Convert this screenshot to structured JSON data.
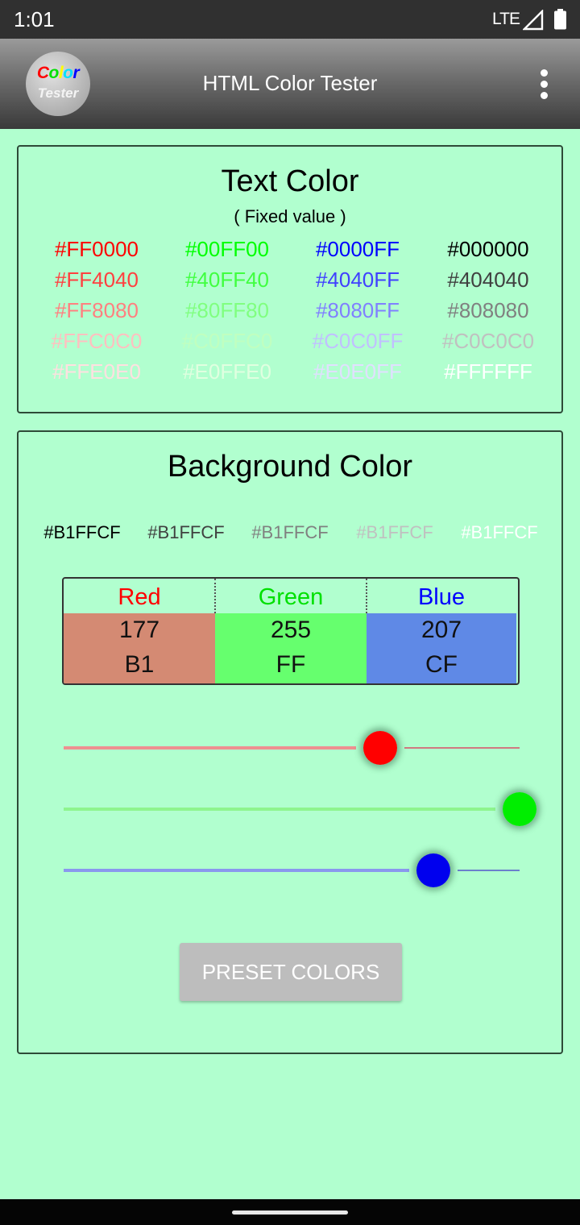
{
  "status_bar": {
    "time": "1:01",
    "network": "LTE",
    "signal_icon": "signal-icon",
    "battery_icon": "battery-icon"
  },
  "app_bar": {
    "title": "HTML Color Tester",
    "logo": {
      "line1_letters": [
        {
          "char": "C",
          "color": "#FF0000"
        },
        {
          "char": "o",
          "color": "#00E000"
        },
        {
          "char": "l",
          "color": "#FFFF00"
        },
        {
          "char": "o",
          "color": "#00E0FF"
        },
        {
          "char": "r",
          "color": "#0000FF"
        }
      ],
      "line2": "Tester"
    },
    "menu_icon": "more-vert-icon"
  },
  "text_color_panel": {
    "title": "Text Color",
    "subtitle": "( Fixed value )",
    "columns": [
      [
        "#FF0000",
        "#FF4040",
        "#FF8080",
        "#FFC0C0",
        "#FFE0E0"
      ],
      [
        "#00FF00",
        "#40FF40",
        "#80FF80",
        "#C0FFC0",
        "#E0FFE0"
      ],
      [
        "#0000FF",
        "#4040FF",
        "#8080FF",
        "#C0C0FF",
        "#E0E0FF"
      ],
      [
        "#000000",
        "#404040",
        "#808080",
        "#C0C0C0",
        "#FFFFFF"
      ]
    ]
  },
  "background_color_panel": {
    "title": "Background Color",
    "current_color": "#B1FFCF",
    "sample_labels": [
      {
        "text": "#B1FFCF",
        "color": "#000000"
      },
      {
        "text": "#B1FFCF",
        "color": "#404040"
      },
      {
        "text": "#B1FFCF",
        "color": "#808080"
      },
      {
        "text": "#B1FFCF",
        "color": "#C0C0C0"
      },
      {
        "text": "#B1FFCF",
        "color": "#FFFFFF"
      }
    ],
    "rgb_table": [
      {
        "label": "Red",
        "label_color": "#FF0000",
        "decimal": "177",
        "hex": "B1",
        "cell_color": "#D48A73"
      },
      {
        "label": "Green",
        "label_color": "#00E000",
        "decimal": "255",
        "hex": "FF",
        "cell_color": "#66FF6E"
      },
      {
        "label": "Blue",
        "label_color": "#0000FF",
        "decimal": "207",
        "hex": "CF",
        "cell_color": "#5F89E6"
      }
    ],
    "sliders": [
      {
        "name": "red",
        "value": 177,
        "max": 255,
        "thumb_color": "#FF0000",
        "track_color": "#EE9090",
        "rest_color": "#D07A80"
      },
      {
        "name": "green",
        "value": 255,
        "max": 255,
        "thumb_color": "#00EE00",
        "track_color": "#8EF58E",
        "rest_color": "#6CCB7A"
      },
      {
        "name": "blue",
        "value": 207,
        "max": 255,
        "thumb_color": "#0000EE",
        "track_color": "#8A98EE",
        "rest_color": "#6B80CC"
      }
    ],
    "preset_button_label": "PRESET COLORS"
  }
}
